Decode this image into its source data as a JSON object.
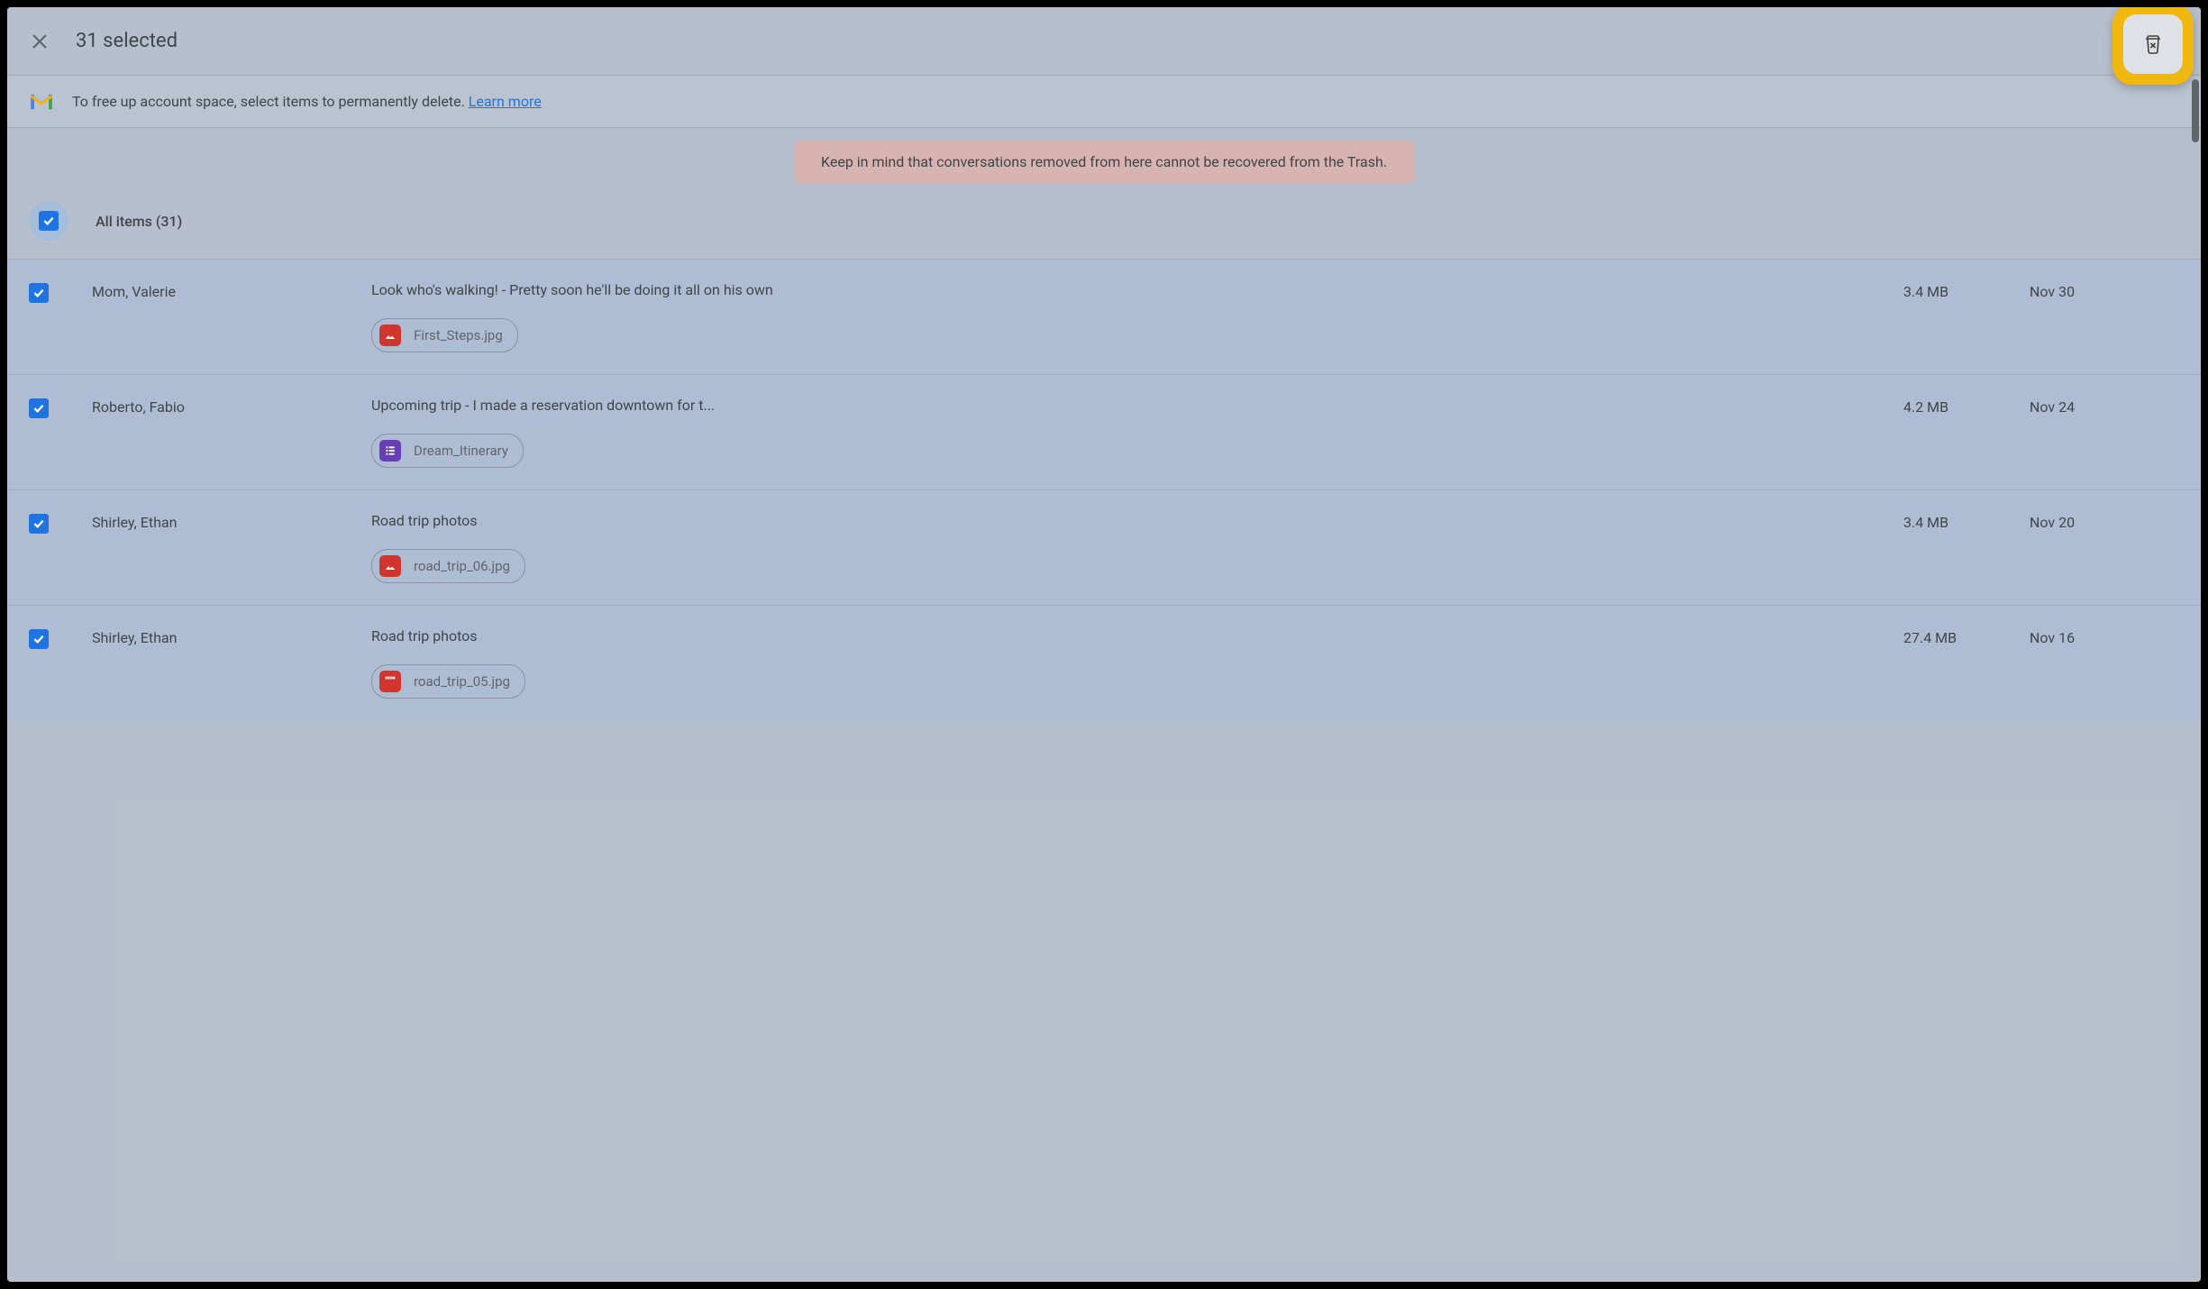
{
  "topbar": {
    "selected_text": "31 selected"
  },
  "infobar": {
    "text": "To free up account space, select items to permanently delete. ",
    "learn_more": "Learn more"
  },
  "warning": "Keep in mind that conversations removed from here cannot be recovered from the Trash.",
  "all_items": {
    "label": "All items (31)"
  },
  "rows": [
    {
      "sender": "Mom, Valerie",
      "subject": "Look who's walking! - Pretty soon he'll be doing it all on his own",
      "attachment": {
        "name": "First_Steps.jpg",
        "type": "image"
      },
      "size": "3.4 MB",
      "date": "Nov 30"
    },
    {
      "sender": "Roberto, Fabio",
      "subject": "Upcoming trip - I made a reservation downtown for t...",
      "attachment": {
        "name": "Dream_Itinerary",
        "type": "doc"
      },
      "size": "4.2 MB",
      "date": "Nov 24"
    },
    {
      "sender": "Shirley, Ethan",
      "subject": "Road trip photos",
      "attachment": {
        "name": "road_trip_06.jpg",
        "type": "image"
      },
      "size": "3.4 MB",
      "date": "Nov 20"
    },
    {
      "sender": "Shirley, Ethan",
      "subject": "Road trip photos",
      "attachment": {
        "name": "road_trip_05.jpg",
        "type": "video"
      },
      "size": "27.4 MB",
      "date": "Nov 16"
    }
  ]
}
